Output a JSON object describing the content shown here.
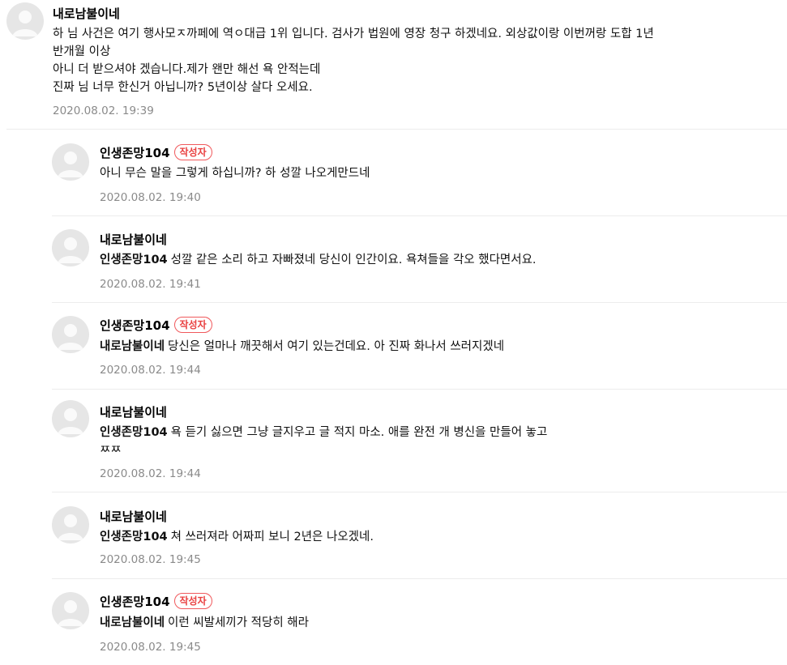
{
  "comments": [
    {
      "author": "내로남불이네",
      "is_writer": false,
      "mention": "",
      "lines": [
        "하 님 사건은 여기 행사모ㅈ까페에 역ㅇ대급 1위 입니다. 검사가 법원에 영장 청구 하겠네요. 외상값이랑 이번꺼랑 도합 1년",
        "반개월 이상",
        "아니 더 받으셔야 겠습니다.제가 왠만 해선 욕 안적는데",
        "진짜 님 너무 한신거 아닙니까? 5년이상 살다 오세요."
      ],
      "date": "2020.08.02. 19:39"
    },
    {
      "author": "인생존망104",
      "is_writer": true,
      "mention": "",
      "lines": [
        "아니 무슨 말을 그렇게 하십니까? 하 성깔 나오게만드네"
      ],
      "date": "2020.08.02. 19:40"
    },
    {
      "author": "내로남불이네",
      "is_writer": false,
      "mention": "인생존망104",
      "lines": [
        "성깔 같은 소리 하고 자빠졌네 당신이 인간이요. 욕쳐들을 각오 했다면서요."
      ],
      "date": "2020.08.02. 19:41"
    },
    {
      "author": "인생존망104",
      "is_writer": true,
      "mention": "내로남불이네",
      "lines": [
        "당신은 얼마나 깨끗해서 여기 있는건데요. 아 진짜 화나서 쓰러지겠네"
      ],
      "date": "2020.08.02. 19:44"
    },
    {
      "author": "내로남불이네",
      "is_writer": false,
      "mention": "인생존망104",
      "lines": [
        "욕 듣기 싫으면 그냥 글지우고 글 적지 마소. 애를 완전 개 병신을 만들어 놓고",
        "ㅉㅉ"
      ],
      "date": "2020.08.02. 19:44"
    },
    {
      "author": "내로남불이네",
      "is_writer": false,
      "mention": "인생존망104",
      "lines": [
        "쳐 쓰러져라 어짜피 보니 2년은 나오겠네."
      ],
      "date": "2020.08.02. 19:45"
    },
    {
      "author": "인생존망104",
      "is_writer": true,
      "mention": "내로남불이네",
      "lines": [
        "이런 씨발세끼가 적당히 해라"
      ],
      "date": "2020.08.02. 19:45"
    }
  ],
  "labels": {
    "writer_badge": "작성자"
  },
  "icons": {
    "avatar": "default-profile-icon"
  },
  "colors": {
    "badge": "#e94040",
    "date": "#8a8a8a",
    "divider": "#ececec",
    "avatar_bg": "#e6e6e6"
  }
}
